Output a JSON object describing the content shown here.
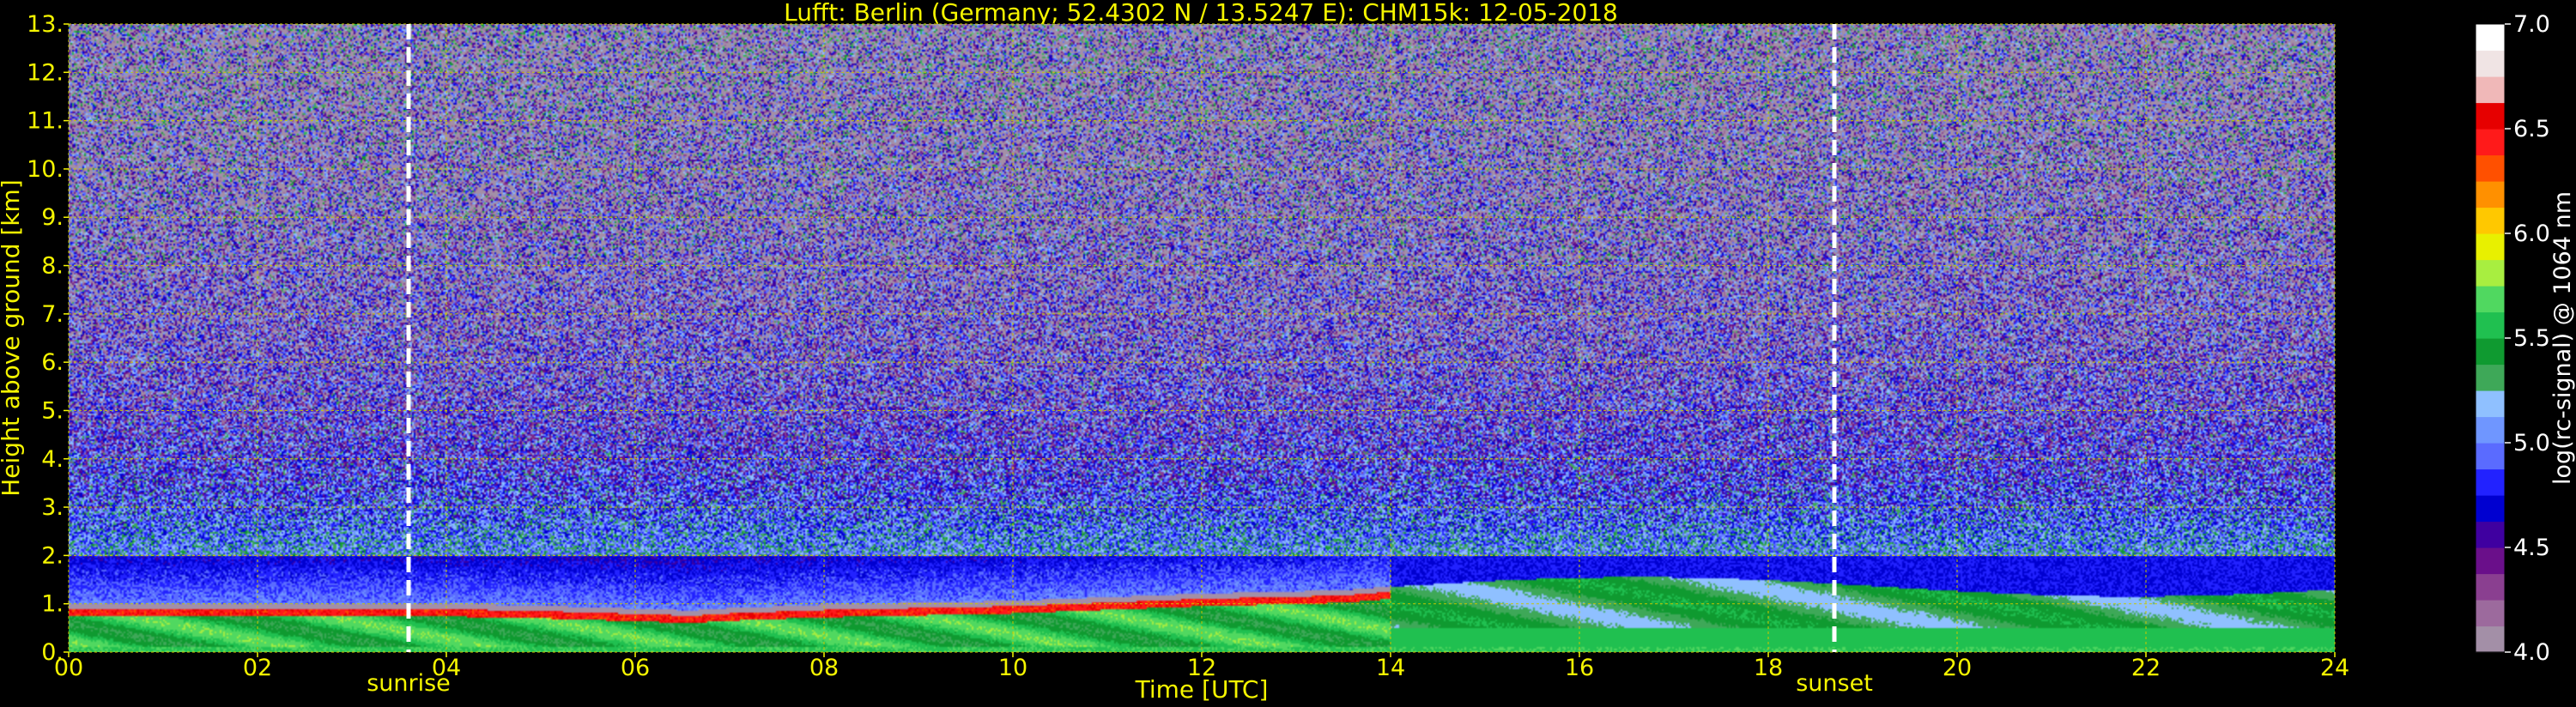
{
  "chart_data": {
    "type": "heatmap",
    "title": "Lufft: Berlin (Germany; 52.4302 N / 13.5247 E):    CHM15k: 12-05-2018",
    "xlabel": "Time [UTC]",
    "ylabel": "Height above ground [km]",
    "xlim": [
      0,
      24
    ],
    "ylim": [
      0,
      13
    ],
    "x_ticks": [
      0,
      2,
      4,
      6,
      8,
      10,
      12,
      14,
      16,
      18,
      20,
      22,
      24
    ],
    "x_tick_labels": [
      "00",
      "02",
      "04",
      "06",
      "08",
      "10",
      "12",
      "14",
      "16",
      "18",
      "20",
      "22",
      "24"
    ],
    "y_ticks": [
      0,
      1,
      2,
      3,
      4,
      5,
      6,
      7,
      8,
      9,
      10,
      11,
      12,
      13
    ],
    "y_tick_labels": [
      "0.",
      "1.",
      "2.",
      "3.",
      "4.",
      "5.",
      "6.",
      "7.",
      "8.",
      "9.",
      "10.",
      "11.",
      "12.",
      "13."
    ],
    "grid": true,
    "grid_color": "#c8c800",
    "annotations": [
      {
        "label": "sunrise",
        "x": 3.6
      },
      {
        "label": "sunset",
        "x": 18.7
      }
    ],
    "boundary_layer_height_km": [
      [
        0,
        0.95
      ],
      [
        3.6,
        0.95
      ],
      [
        5.0,
        0.9
      ],
      [
        6.6,
        0.8
      ],
      [
        7.0,
        0.85
      ],
      [
        8.0,
        0.92
      ],
      [
        10.0,
        1.0
      ],
      [
        12.0,
        1.15
      ],
      [
        13.5,
        1.22
      ],
      [
        14.0,
        1.3
      ]
    ],
    "colorbar": {
      "label": "log(rc-signal) @ 1064 nm",
      "range": [
        4.0,
        7.0
      ],
      "ticks": [
        4.0,
        4.5,
        5.0,
        5.5,
        6.0,
        6.5,
        7.0
      ],
      "tick_labels": [
        "4.0",
        "4.5",
        "5.0",
        "5.5",
        "6.0",
        "6.5",
        "7.0"
      ],
      "colors": [
        "#a38fa7",
        "#9c6a9d",
        "#8a3f90",
        "#6a0f8a",
        "#3f00a0",
        "#0000d0",
        "#2222ff",
        "#5a6bff",
        "#6f96ff",
        "#8fc0ff",
        "#3ea858",
        "#0f9a30",
        "#20c050",
        "#50d860",
        "#a8ee40",
        "#e8f000",
        "#ffc800",
        "#ff9000",
        "#ff5000",
        "#ff1a1a",
        "#e60000",
        "#f0b8b8",
        "#f0e4e4",
        "#ffffff"
      ]
    }
  }
}
